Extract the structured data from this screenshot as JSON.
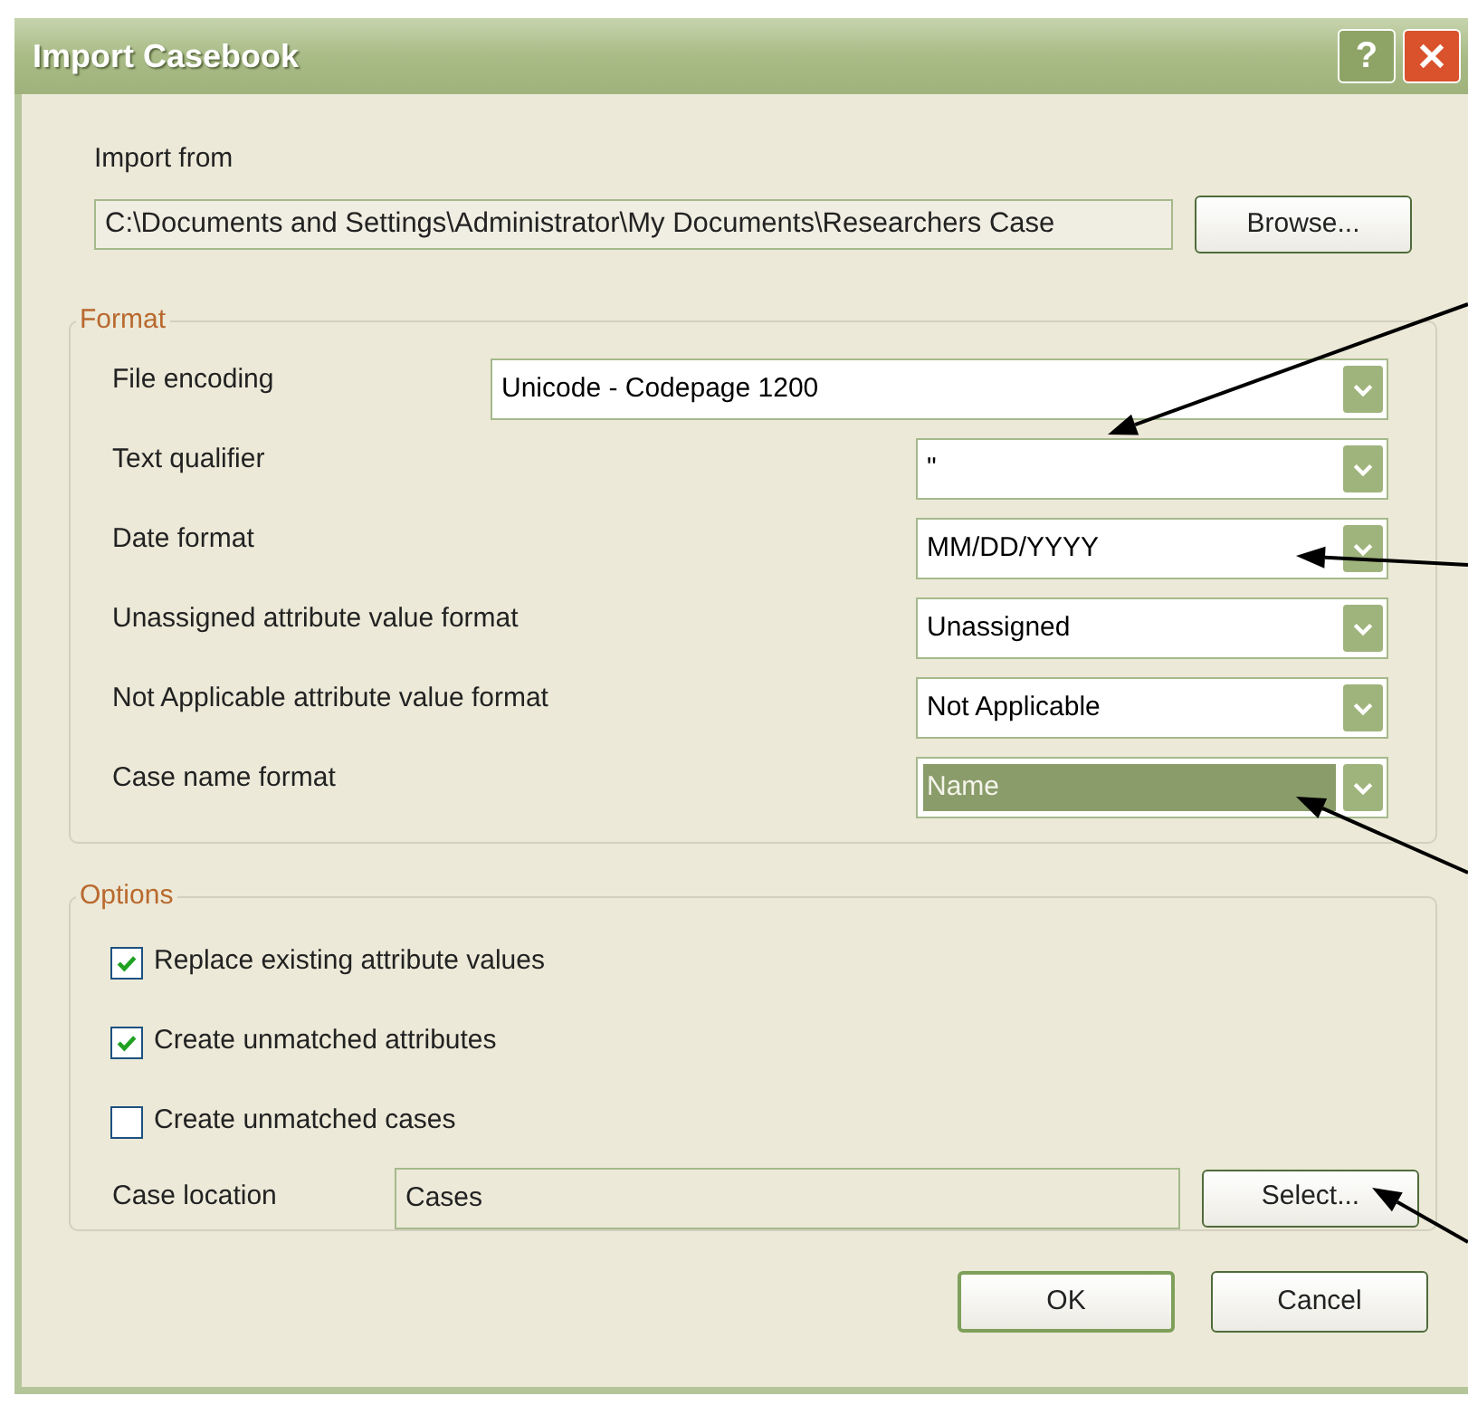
{
  "window": {
    "title": "Import Casebook",
    "help_button": "?"
  },
  "import_from": {
    "label": "Import from",
    "path": "C:\\Documents and Settings\\Administrator\\My Documents\\Researchers Case",
    "browse_button": "Browse..."
  },
  "format": {
    "title": "Format",
    "fields": [
      {
        "label": "File encoding",
        "value": "Unicode - Codepage 1200",
        "selected": false
      },
      {
        "label": "Text qualifier",
        "value": "\"",
        "selected": false
      },
      {
        "label": "Date format",
        "value": "MM/DD/YYYY",
        "selected": false
      },
      {
        "label": "Unassigned attribute value format",
        "value": "Unassigned",
        "selected": false
      },
      {
        "label": "Not Applicable attribute value format",
        "value": "Not Applicable",
        "selected": false
      },
      {
        "label": "Case name format",
        "value": "Name",
        "selected": true
      }
    ]
  },
  "options": {
    "title": "Options",
    "checkboxes": [
      {
        "label": "Replace existing attribute values",
        "checked": true
      },
      {
        "label": "Create unmatched attributes",
        "checked": true
      },
      {
        "label": "Create unmatched cases",
        "checked": false
      }
    ],
    "case_location": {
      "label": "Case location",
      "value": "Cases",
      "button": "Select..."
    }
  },
  "buttons": [
    {
      "label": "OK",
      "default": true
    },
    {
      "label": "Cancel",
      "default": false
    }
  ]
}
